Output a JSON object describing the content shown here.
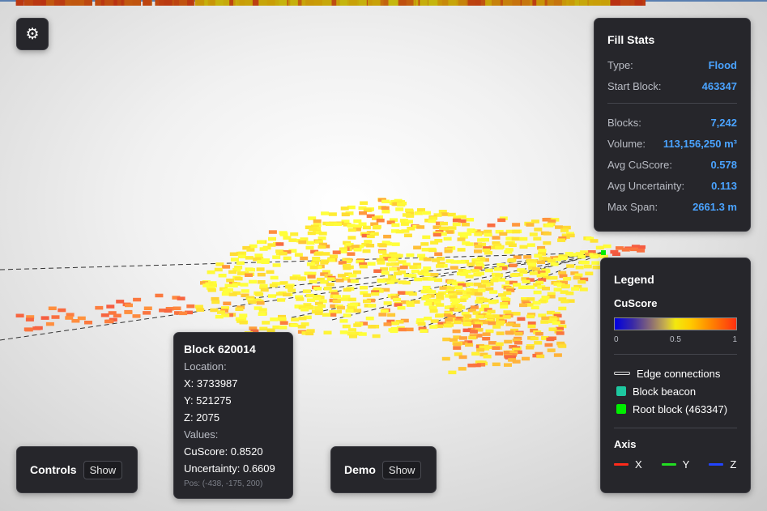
{
  "settings": {
    "icon": "gear-icon",
    "glyph": "⚙"
  },
  "fill_stats": {
    "title": "Fill Stats",
    "type_label": "Type:",
    "type_value": "Flood",
    "start_label": "Start Block:",
    "start_value": "463347",
    "blocks_label": "Blocks:",
    "blocks_value": "7,242",
    "volume_label": "Volume:",
    "volume_value": "113,156,250 m³",
    "avg_cu_label": "Avg CuScore:",
    "avg_cu_value": "0.578",
    "avg_unc_label": "Avg Uncertainty:",
    "avg_unc_value": "0.113",
    "span_label": "Max Span:",
    "span_value": "2661.3 m"
  },
  "legend": {
    "title": "Legend",
    "scale_title": "CuScore",
    "ticks": [
      "0",
      "0.5",
      "1"
    ],
    "edge_label": "Edge connections",
    "beacon_label": "Block beacon",
    "root_label": "Root block (463347)",
    "axis_title": "Axis",
    "axis_x": "X",
    "axis_y": "Y",
    "axis_z": "Z",
    "colors": {
      "beacon": "#1ec8a0",
      "root": "#00ee00",
      "x": "#ff2a1a",
      "y": "#22dd22",
      "z": "#2244ff"
    }
  },
  "block_info": {
    "title": "Block 620014",
    "location_label": "Location:",
    "x": "X: 3733987",
    "y": "Y: 521275",
    "z": "Z: 2075",
    "values_label": "Values:",
    "cuscore": "CuScore: 0.8520",
    "uncertainty": "Uncertainty: 0.6609",
    "pos": "Pos: (-438, -175, 200)"
  },
  "controls": {
    "label": "Controls",
    "button": "Show"
  },
  "demo": {
    "label": "Demo",
    "button": "Show"
  }
}
